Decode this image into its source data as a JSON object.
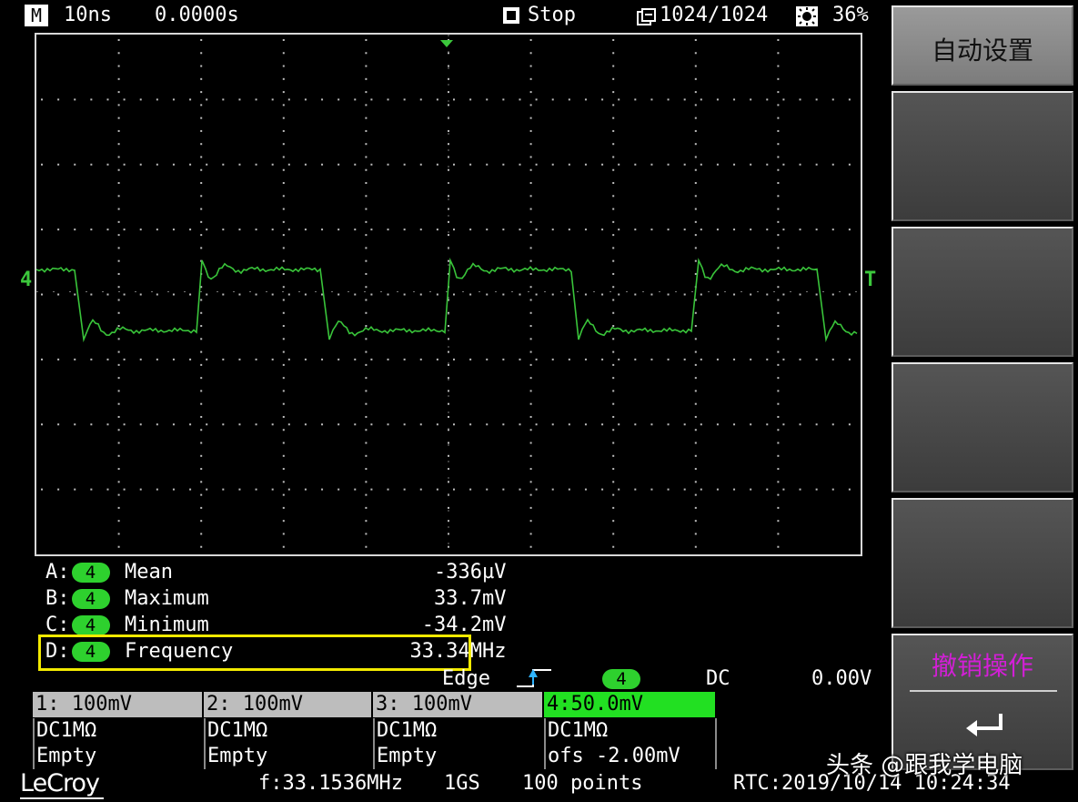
{
  "topbar": {
    "mode_icon": "M",
    "timebase": "10ns",
    "delay": "0.0000s",
    "run_state": "Stop",
    "acq_count": "1024/1024",
    "intensity": "36%"
  },
  "softkeys": [
    {
      "label": "自动设置"
    },
    {
      "label": ""
    },
    {
      "label": ""
    },
    {
      "label": ""
    },
    {
      "label": ""
    },
    {
      "label": "撤销操作"
    }
  ],
  "markers": {
    "channel": "4",
    "trigger": "T"
  },
  "measurements": [
    {
      "slot": "A:",
      "channel": "4",
      "name": "Mean",
      "value": "-336µV"
    },
    {
      "slot": "B:",
      "channel": "4",
      "name": "Maximum",
      "value": "33.7mV"
    },
    {
      "slot": "C:",
      "channel": "4",
      "name": "Minimum",
      "value": "-34.2mV"
    },
    {
      "slot": "D:",
      "channel": "4",
      "name": "Frequency",
      "value": "33.34MHz"
    }
  ],
  "trigger": {
    "type": "Edge",
    "channel": "4",
    "coupling": "DC",
    "level": "0.00V"
  },
  "channels": [
    {
      "head": "1: 100mV",
      "coupling": "DC1MΩ",
      "status": "Empty"
    },
    {
      "head": "2: 100mV",
      "coupling": "DC1MΩ",
      "status": "Empty"
    },
    {
      "head": "3: 100mV",
      "coupling": "DC1MΩ",
      "status": "Empty"
    },
    {
      "head": "4:50.0mV",
      "coupling": "DC1MΩ",
      "status": "ofs  -2.00mV"
    }
  ],
  "footer": {
    "brand": "LeCroy",
    "frequency": "f:33.1536MHz",
    "sample_rate": "1GS",
    "points": "100 points",
    "rtc": "RTC:2019/10/14 10:24:34"
  },
  "watermark": "头条 @跟我学电脑",
  "colors": {
    "trace": "#39c43a",
    "highlight_box": "#f2ea00",
    "softkey_text_magenta": "#d21fd6"
  }
}
